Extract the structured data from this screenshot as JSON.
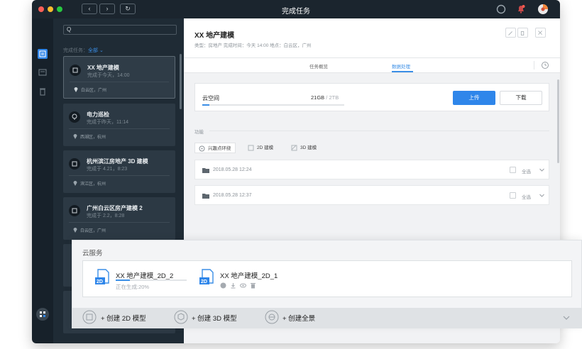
{
  "window": {
    "title": "完成任务"
  },
  "list": {
    "search_placeholder": "Q",
    "filter_prefix": "完成任务：",
    "filter_value": "全部",
    "items": [
      {
        "title": "XX 地产建模",
        "sub": "完成于今天，14:00",
        "loc": "白云区，广州"
      },
      {
        "title": "电力巡检",
        "sub": "完成于昨天，11:14",
        "loc": "西湖区，杭州"
      },
      {
        "title": "杭州滨江房地产 3D 建模",
        "sub": "完成于 4.21，8:23",
        "loc": "滨江区，杭州"
      },
      {
        "title": "广州白云区房产建模 2",
        "sub": "完成于 2.2，8:28",
        "loc": "白云区，广州"
      }
    ]
  },
  "detail": {
    "title": "XX 地产建模",
    "meta": "类型：房地产    完成时间：今天 14:00    地点：白云区，广州",
    "tabs": [
      "任务概览",
      "数据处理"
    ],
    "active_tab": "数据处理",
    "cloud": {
      "label": "云空间",
      "used": "21GB",
      "total": " / 2TB",
      "fraction": 0.05,
      "upload": "上传",
      "download": "下载"
    },
    "features_label": "功能",
    "features": [
      "兴趣点环绕",
      "2D 建模",
      "3D 建模"
    ],
    "folders": [
      {
        "date": "2018.05.28 12:24",
        "select": "全选"
      },
      {
        "date": "2018.05.28 12:37",
        "select": "全选"
      }
    ]
  },
  "cloud_service": {
    "title": "云服务",
    "files": [
      {
        "name": "XX 地产建模_2D_2",
        "status": "正在生成:20%",
        "progress": 0.2,
        "badge": "2D"
      },
      {
        "name": "XX 地产建模_2D_1",
        "badge": "2D"
      }
    ],
    "actions": [
      "+ 创建 2D 模型",
      "+ 创建 3D 模型",
      "+ 创建全景"
    ]
  },
  "colors": {
    "accent": "#3a8ee6",
    "sidebar": "#1f2b35",
    "titlebar": "#1b252e"
  }
}
